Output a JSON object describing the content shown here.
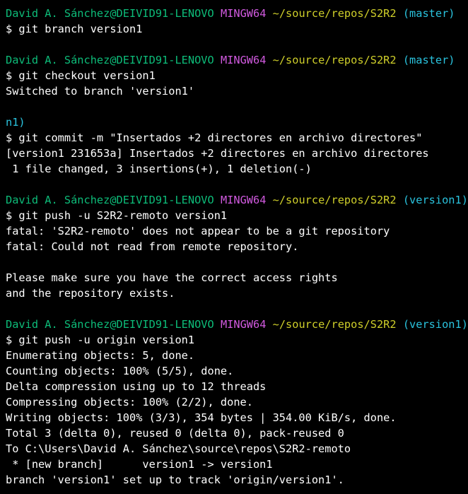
{
  "terminal": {
    "colors": {
      "background": "#000000",
      "text": "#ffffff",
      "user": "#0dbc79",
      "env": "#d15adf",
      "path": "#cfcf2a",
      "branch": "#2ac3de"
    },
    "lines": [
      {
        "type": "prompt",
        "user": "David A. Sánchez@DEIVID91-LENOVO",
        "env": "MINGW64",
        "path": "~/source/repos/S2R2",
        "branch": "(master)"
      },
      {
        "type": "text",
        "text": "$ git branch version1"
      },
      {
        "type": "blank"
      },
      {
        "type": "prompt",
        "user": "David A. Sánchez@DEIVID91-LENOVO",
        "env": "MINGW64",
        "path": "~/source/repos/S2R2",
        "branch": "(master)"
      },
      {
        "type": "text",
        "text": "$ git checkout version1"
      },
      {
        "type": "text",
        "text": "Switched to branch 'version1'"
      },
      {
        "type": "blank"
      },
      {
        "type": "branch-fragment",
        "text": "n1)"
      },
      {
        "type": "text",
        "text": "$ git commit -m \"Insertados +2 directores en archivo directores\""
      },
      {
        "type": "text",
        "text": "[version1 231653a] Insertados +2 directores en archivo directores"
      },
      {
        "type": "text",
        "text": " 1 file changed, 3 insertions(+), 1 deletion(-)"
      },
      {
        "type": "blank"
      },
      {
        "type": "prompt",
        "user": "David A. Sánchez@DEIVID91-LENOVO",
        "env": "MINGW64",
        "path": "~/source/repos/S2R2",
        "branch": "(version1)"
      },
      {
        "type": "text",
        "text": "$ git push -u S2R2-remoto version1"
      },
      {
        "type": "text",
        "text": "fatal: 'S2R2-remoto' does not appear to be a git repository"
      },
      {
        "type": "text",
        "text": "fatal: Could not read from remote repository."
      },
      {
        "type": "blank"
      },
      {
        "type": "text",
        "text": "Please make sure you have the correct access rights"
      },
      {
        "type": "text",
        "text": "and the repository exists."
      },
      {
        "type": "blank"
      },
      {
        "type": "prompt",
        "user": "David A. Sánchez@DEIVID91-LENOVO",
        "env": "MINGW64",
        "path": "~/source/repos/S2R2",
        "branch": "(version1)"
      },
      {
        "type": "text",
        "text": "$ git push -u origin version1"
      },
      {
        "type": "text",
        "text": "Enumerating objects: 5, done."
      },
      {
        "type": "text",
        "text": "Counting objects: 100% (5/5), done."
      },
      {
        "type": "text",
        "text": "Delta compression using up to 12 threads"
      },
      {
        "type": "text",
        "text": "Compressing objects: 100% (2/2), done."
      },
      {
        "type": "text",
        "text": "Writing objects: 100% (3/3), 354 bytes | 354.00 KiB/s, done."
      },
      {
        "type": "text",
        "text": "Total 3 (delta 0), reused 0 (delta 0), pack-reused 0"
      },
      {
        "type": "text",
        "text": "To C:\\Users\\David A. Sánchez\\source\\repos\\S2R2-remoto"
      },
      {
        "type": "text",
        "text": " * [new branch]      version1 -> version1"
      },
      {
        "type": "text",
        "text": "branch 'version1' set up to track 'origin/version1'."
      }
    ]
  }
}
